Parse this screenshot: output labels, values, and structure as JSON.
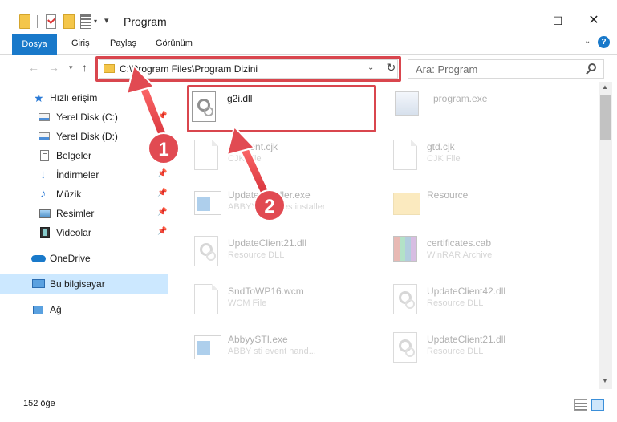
{
  "window": {
    "title": "Program",
    "minimize": "—",
    "maximize": "☐",
    "close": "✕"
  },
  "ribbon": {
    "file_tab": "Dosya",
    "home_tab": "Giriş",
    "share_tab": "Paylaş",
    "view_tab": "Görünüm",
    "help": "?"
  },
  "nav": {
    "address": "C:\\Program Files\\Program Dizini",
    "search_placeholder": "Ara: Program"
  },
  "sidebar": {
    "items": [
      {
        "label": "Hızlı erişim",
        "icon": "star-icon"
      },
      {
        "label": "Yerel Disk (C:)",
        "icon": "drive-icon"
      },
      {
        "label": "Yerel Disk (D:)",
        "icon": "drive-icon"
      },
      {
        "label": "Belgeler",
        "icon": "documents-icon"
      },
      {
        "label": "İndirmeler",
        "icon": "download-icon"
      },
      {
        "label": "Müzik",
        "icon": "music-icon"
      },
      {
        "label": "Resimler",
        "icon": "pictures-icon"
      },
      {
        "label": "Videolar",
        "icon": "videos-icon"
      },
      {
        "label": "OneDrive",
        "icon": "cloud-icon"
      },
      {
        "label": "Bu bilgisayar",
        "icon": "computer-icon"
      },
      {
        "label": "Ağ",
        "icon": "network-icon"
      }
    ]
  },
  "files": [
    {
      "name": "g2i.dll",
      "type": ""
    },
    {
      "name": "program.exe",
      "type": ""
    },
    {
      "name": "Element.cjk",
      "type": "CJK File"
    },
    {
      "name": "gtd.cjk",
      "type": "CJK File"
    },
    {
      "name": "UpdateInstaller.exe",
      "type": "ABBYY Updates installer"
    },
    {
      "name": "Resource",
      "type": ""
    },
    {
      "name": "UpdateClient21.dll",
      "type": "Resource DLL"
    },
    {
      "name": "certificates.cab",
      "type": "WinRAR Archive"
    },
    {
      "name": "SndToWP16.wcm",
      "type": "WCM File"
    },
    {
      "name": "UpdateClient42.dll",
      "type": "Resource DLL"
    },
    {
      "name": "AbbyySTI.exe",
      "type": "ABBY sti event hand..."
    },
    {
      "name": "UpdateClient21.dll",
      "type": "Resource DLL"
    }
  ],
  "annotations": {
    "step1": "1",
    "step2": "2"
  },
  "status": {
    "count": "152 öğe"
  },
  "colors": {
    "accent": "#1979ca",
    "highlight": "#d9464e",
    "selection": "#cce8ff"
  }
}
